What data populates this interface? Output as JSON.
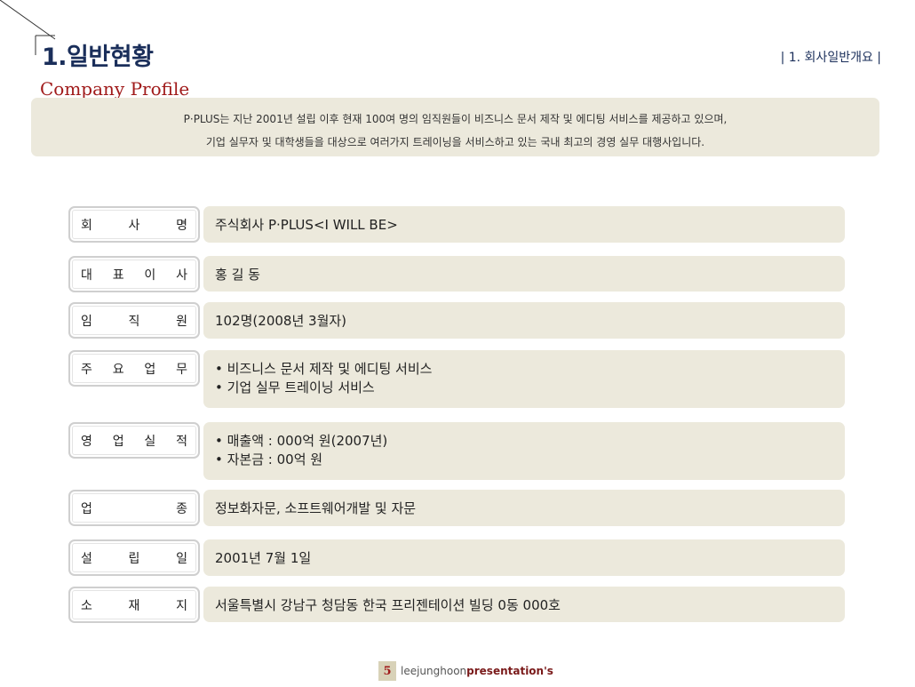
{
  "header": {
    "title": "1.일반현황",
    "section_label": "| 1. 회사일반개요 |",
    "subtitle": "Company Profile"
  },
  "intro": {
    "line1": "P·PLUS는 지난 2001년 설립 이후 현재 100여 명의 임직원들이 비즈니스 문서 제작 및 에디팅 서비스를 제공하고 있으며,",
    "line2": "기업 실무자 및 대학생들을 대상으로 여러가지 트레이닝을 서비스하고 있는 국내 최고의 경영 실무 대행사입니다."
  },
  "rows": [
    {
      "label": [
        "회",
        "사",
        "명"
      ],
      "values": [
        "주식회사 P·PLUS<I WILL BE>"
      ]
    },
    {
      "label": [
        "대",
        "표",
        "이",
        "사"
      ],
      "values": [
        "홍 길 동"
      ]
    },
    {
      "label": [
        "임",
        "직",
        "원"
      ],
      "values": [
        "102명(2008년 3월자)"
      ]
    },
    {
      "label": [
        "주",
        "요",
        "업",
        "무"
      ],
      "values": [
        "• 비즈니스 문서 제작 및 에디팅 서비스",
        "• 기업 실무 트레이닝 서비스"
      ]
    },
    {
      "label": [
        "영",
        "업",
        "실",
        "적"
      ],
      "values": [
        "• 매출액 : 000억 원(2007년)",
        "• 자본금 : 00억 원"
      ]
    },
    {
      "label": [
        "업",
        "종"
      ],
      "values": [
        "정보화자문, 소프트웨어개발 및 자문"
      ]
    },
    {
      "label": [
        "설",
        "립",
        "일"
      ],
      "values": [
        "2001년 7월 1일"
      ]
    },
    {
      "label": [
        "소",
        "재",
        "지"
      ],
      "values": [
        "서울특별시 강남구 청담동 한국 프리젠테이션 빌딩 0동 000호"
      ]
    }
  ],
  "footer": {
    "page_number": "5",
    "brand_a": "leejunghoon",
    "brand_b": "presentation's"
  }
}
